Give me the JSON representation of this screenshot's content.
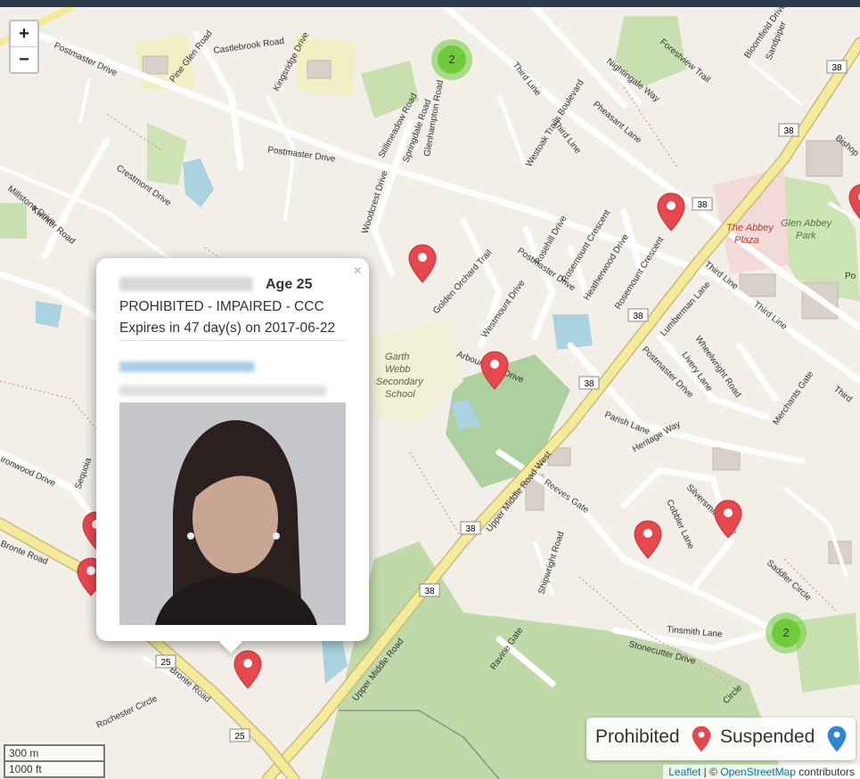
{
  "zoom": {
    "in_label": "+",
    "out_label": "−"
  },
  "popup": {
    "age": "Age 25",
    "status": "PROHIBITED - IMPAIRED - CCC",
    "expires": "Expires in 47 day(s) on 2017-06-22",
    "close_label": "×"
  },
  "legend": {
    "prohibited_label": "Prohibited",
    "suspended_label": "Suspended"
  },
  "colors": {
    "prohibited_marker": "#e8474d",
    "suspended_marker": "#2f86d6",
    "cluster": "#6ecc39",
    "main_road": "#f3ea9a"
  },
  "clusters": [
    {
      "count": "2"
    },
    {
      "count": "2"
    }
  ],
  "scale": {
    "metric": "300 m",
    "imperial": "1000 ft"
  },
  "attribution": {
    "leaflet": "Leaflet",
    "sep": " | © ",
    "osm": "OpenStreetMap",
    "contributors": " contributors"
  },
  "roads": {
    "postmaster_1": "Postmaster Drive",
    "postmaster_2": "Postmaster Drive",
    "postmaster_3": "Postmaster Drive",
    "postmaster_4": "Postmaster Drive",
    "third_line_1": "Third Line",
    "third_line_2": "Third Line",
    "third_line_3": "Third Line",
    "third_line_4": "Third Line",
    "upper_middle_1": "Upper Middle Road West",
    "upper_middle_2": "Upper Middle Road",
    "bronte_1": "Bronte Road",
    "bronte_2": "Bronte Road",
    "westoak": "Westoak Trails Boulevard",
    "castlebrook": "Castlebrook Road",
    "pine_glen": "Pine Glen Road",
    "kingsridge": "Kingsridge Drive",
    "crestmont": "Crestmont Drive",
    "millstone": "Millstone Drive",
    "kwinter": "Kwinter Road",
    "stillmeadow": "Stillmeadow Road",
    "springdale": "Springdale Road",
    "glenhampton": "Glenhampton Road",
    "woodcrest": "Woodcrest Drive",
    "nightingale": "Nightingale Way",
    "pheasant": "Pheasant Lane",
    "forestview": "Forestview Trail",
    "bloomfield": "Bloomfield Drive",
    "sandpiper": "Sandpiper",
    "bishop": "Bishop",
    "golden_orchard": "Golden Orchard Trail",
    "rosehill": "Rosehill Drive",
    "rosemount_1": "Rosemount Crescent",
    "rosemount_2": "Rosemount Crescent",
    "heatherwood": "Heatherwood Drive",
    "westmount": "Westmount Drive",
    "arbour": "Arbour Glen Drive",
    "lumberman": "Lumberman Lane",
    "livery": "Livery Lane",
    "wheelwright": "Wheelwright Road",
    "merchants": "Merchants Gate",
    "parish": "Parish Lane",
    "heritage": "Heritage Way",
    "reeves": "Reeves Gate",
    "silversmith": "Silversmith Drive",
    "cobbler": "Cobbler Lane",
    "saddler": "Saddler Circle",
    "tinsmith": "Tinsmith Lane",
    "stonecutter": "Stonecutter Drive",
    "ravine": "Ravine Gate",
    "shipwright": "Shipwright Road",
    "rochester": "Rochester Circle",
    "ironwood": "ironwood Drive",
    "sequoia": "Sequoia",
    "circle": "Circle",
    "third_partial": "Third",
    "glen_abbey_p": "Po"
  },
  "places": {
    "abbey_1": "The Abbey",
    "abbey_2": "Plaza",
    "glen_abbey_1": "Glen Abbey",
    "glen_abbey_2": "Park",
    "garth_1": "Garth",
    "garth_2": "Webb",
    "garth_3": "Secondary",
    "garth_4": "School"
  },
  "shields": {
    "s1": "38",
    "s2": "38",
    "s3": "38",
    "s4": "38",
    "s5": "38",
    "s6": "38",
    "s7": "38",
    "s8": "25",
    "s9": "25"
  }
}
